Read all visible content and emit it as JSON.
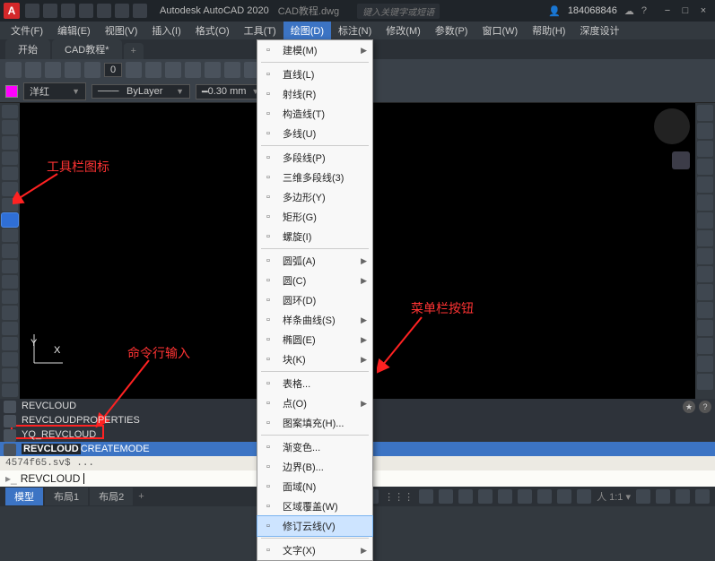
{
  "title": {
    "app": "Autodesk AutoCAD 2020",
    "doc": "CAD教程.dwg",
    "search_ph": "键入关键字或短语",
    "user": "184068846"
  },
  "menubar": [
    "文件(F)",
    "编辑(E)",
    "视图(V)",
    "插入(I)",
    "格式(O)",
    "工具(T)",
    "绘图(D)",
    "标注(N)",
    "修改(M)",
    "参数(P)",
    "窗口(W)",
    "帮助(H)",
    "深度设计"
  ],
  "menubar_active": 6,
  "filetabs": {
    "start": "开始",
    "doc": "CAD教程*"
  },
  "ribbon": {
    "num": "0"
  },
  "props": {
    "colorname": "洋红",
    "layer": "ByLayer",
    "lw": "0.30 mm"
  },
  "dropdown": {
    "top": "建模(M)",
    "g1": [
      "直线(L)",
      "射线(R)",
      "构造线(T)",
      "多线(U)"
    ],
    "g2": [
      "多段线(P)",
      "三维多段线(3)",
      "多边形(Y)",
      "矩形(G)",
      "螺旋(I)"
    ],
    "g3": [
      "圆弧(A)",
      "圆(C)",
      "圆环(D)",
      "样条曲线(S)",
      "椭圆(E)",
      "块(K)"
    ],
    "g4": [
      "表格...",
      "点(O)",
      "图案填充(H)..."
    ],
    "g5": [
      "渐变色...",
      "边界(B)...",
      "面域(N)",
      "区域覆盖(W)",
      "修订云线(V)"
    ],
    "g6": "文字(X)",
    "selected": "修订云线(V)"
  },
  "annot": {
    "toolbar": "工具栏图标",
    "cmd": "命令行输入",
    "menu": "菜单栏按钮"
  },
  "suggest": {
    "rows": [
      "REVCLOUD",
      "REVCLOUDPROPERTIES",
      "YQ_REVCLOUD"
    ],
    "hl": "REVCLOUDCREATEMODE"
  },
  "cmdhist": "4574f65.sv$ ...",
  "cmdinput": "REVCLOUD",
  "status": {
    "tabs": [
      "模型",
      "布局1",
      "布局2"
    ],
    "label": "模型"
  },
  "ucs": {
    "y": "Y",
    "x": "X"
  }
}
